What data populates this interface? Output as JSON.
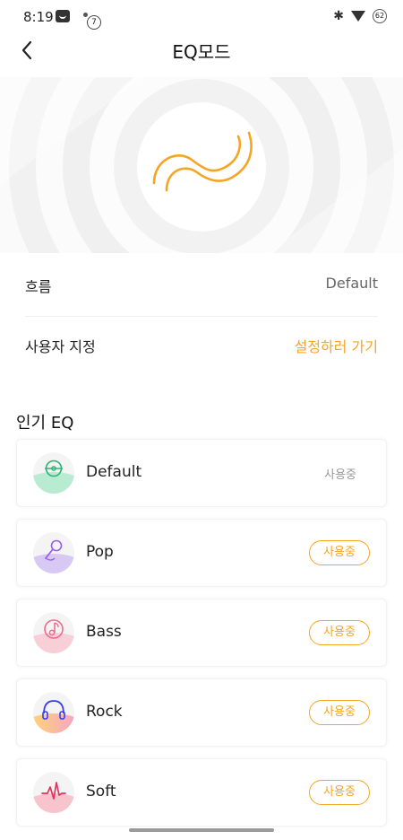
{
  "status_bar": {
    "time": "8:19",
    "notification_count": "7",
    "bluetooth": "✱",
    "battery": "62"
  },
  "header": {
    "title": "EQ모드",
    "back_icon": "chevron-left-icon"
  },
  "hero": {
    "icon": "wave-icon",
    "accent_color": "#f5a524"
  },
  "settings": {
    "flow": {
      "label": "흐름",
      "value": "Default"
    },
    "custom": {
      "label": "사용자 지정",
      "link": "설정하러 가기"
    }
  },
  "popular": {
    "title": "인기 EQ",
    "items": [
      {
        "name": "Default",
        "status": "사용중",
        "icon": "music-disc-icon",
        "active": true
      },
      {
        "name": "Pop",
        "status": "사용중",
        "icon": "microphone-icon",
        "active": false
      },
      {
        "name": "Bass",
        "status": "사용중",
        "icon": "music-note-icon",
        "active": false
      },
      {
        "name": "Rock",
        "status": "사용중",
        "icon": "headphones-icon",
        "active": false
      },
      {
        "name": "Soft",
        "status": "사용중",
        "icon": "heartbeat-icon",
        "active": false
      }
    ]
  }
}
